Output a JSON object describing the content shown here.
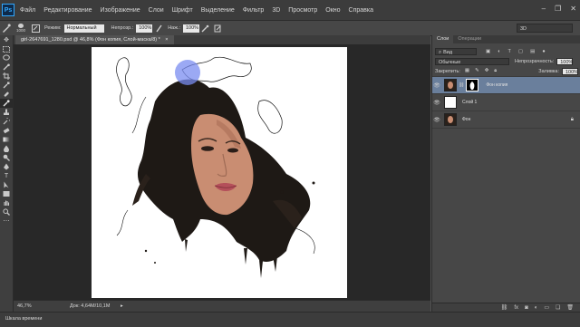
{
  "app": {
    "logo": "Ps"
  },
  "menu": [
    "Файл",
    "Редактирование",
    "Изображение",
    "Слои",
    "Шрифт",
    "Выделение",
    "Фильтр",
    "3D",
    "Просмотр",
    "Окно",
    "Справка"
  ],
  "window_controls": {
    "minimize": "–",
    "restore": "❐",
    "close": "✕"
  },
  "options": {
    "brush_size": "1000",
    "mode_label": "Режим:",
    "mode_value": "Нормальный",
    "opacity_label": "Непрозр.:",
    "opacity_value": "100%",
    "flow_label": "Наж.:",
    "flow_value": "100%",
    "workspace": "3D"
  },
  "document": {
    "tab_title": "girl-2647691_1280.psd @ 46,8% (Фон копия, Слой-маска/8) *",
    "tab_close": "×"
  },
  "status": {
    "zoom": "46,7%",
    "doc_size": "Док: 4,64M/10,1M",
    "arrow": "▸"
  },
  "timeline": {
    "label": "Шкала времени"
  },
  "layers_panel": {
    "tabs": [
      "Слои",
      "Операции"
    ],
    "filter_label": "Вид",
    "blend_mode": "Обычные",
    "opacity_label": "Непрозрачность:",
    "opacity_value": "100%",
    "lock_label": "Закрепить:",
    "fill_label": "Заливка:",
    "fill_value": "100%",
    "layers": [
      {
        "name": "Фон копия",
        "active": true
      },
      {
        "name": "Слой 1",
        "active": false
      },
      {
        "name": "Фон",
        "active": false
      }
    ]
  },
  "colors": {
    "accent": "#6a7f9c",
    "brush_cursor": "#7a8cf0",
    "ps_blue": "#31a8ff"
  }
}
